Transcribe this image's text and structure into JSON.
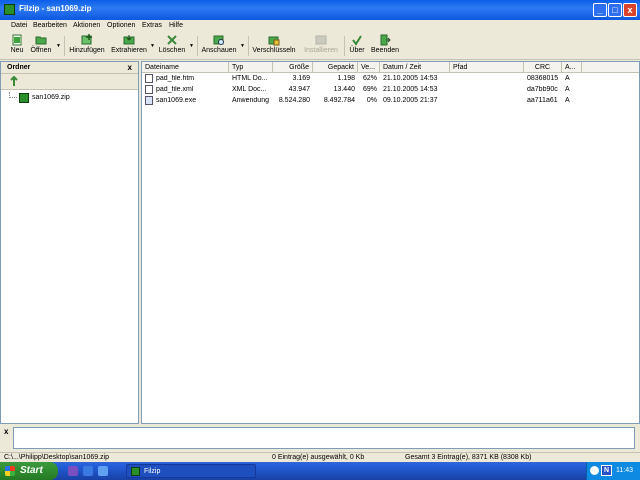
{
  "window": {
    "title": "Filzip - san1069.zip",
    "minimize": "_",
    "maximize": "□",
    "close": "x"
  },
  "menu": [
    "Datei",
    "Bearbeiten",
    "Aktionen",
    "Optionen",
    "Extras",
    "Hilfe"
  ],
  "toolbar": [
    {
      "label": "Neu",
      "icon": "new-icon"
    },
    {
      "label": "Öffnen",
      "icon": "open-folder-icon"
    },
    {
      "label": "Hinzufügen",
      "icon": "add-icon"
    },
    {
      "label": "Extrahieren",
      "icon": "extract-icon"
    },
    {
      "label": "Löschen",
      "icon": "delete-icon"
    },
    {
      "label": "Anschauen",
      "icon": "view-icon"
    },
    {
      "label": "Verschlüsseln",
      "icon": "encrypt-icon"
    },
    {
      "label": "Installieren",
      "icon": "install-icon",
      "disabled": true
    },
    {
      "label": "Über",
      "icon": "about-icon"
    },
    {
      "label": "Beenden",
      "icon": "exit-icon"
    }
  ],
  "left_panel": {
    "title": "Ordner",
    "close": "x",
    "tree": [
      {
        "label": "san1069.zip"
      }
    ]
  },
  "columns": [
    "Dateiname",
    "Typ",
    "Größe",
    "Gepackt",
    "Ve...",
    "Datum / Zeit",
    "Pfad",
    "CRC",
    "A..."
  ],
  "files": [
    {
      "name": "pad_file.htm",
      "type": "HTML Do...",
      "size": "3.169",
      "packed": "1.198",
      "ratio": "62%",
      "date": "21.10.2005 14:53",
      "path": "",
      "crc": "08368015",
      "attr": "A"
    },
    {
      "name": "pad_file.xml",
      "type": "XML Doc...",
      "size": "43.947",
      "packed": "13.440",
      "ratio": "69%",
      "date": "21.10.2005 14:53",
      "path": "",
      "crc": "da7bb90c",
      "attr": "A"
    },
    {
      "name": "san1069.exe",
      "type": "Anwendung",
      "size": "8.524.280",
      "packed": "8.492.784",
      "ratio": "0%",
      "date": "09.10.2005 21:37",
      "path": "",
      "crc": "aa711a61",
      "attr": "A"
    }
  ],
  "bottom_panel": {
    "close": "x"
  },
  "status": {
    "path": "C:\\...\\Philipp\\Desktop\\san1069.zip",
    "selected": "0 Eintrag(e) ausgewählt, 0 Kb",
    "total": "Gesamt 3 Eintrag(e), 8371 KB (8308 Kb)"
  },
  "taskbar": {
    "start": "Start",
    "task": "Filzip",
    "clock": "11:43",
    "tray_letter": "N"
  }
}
